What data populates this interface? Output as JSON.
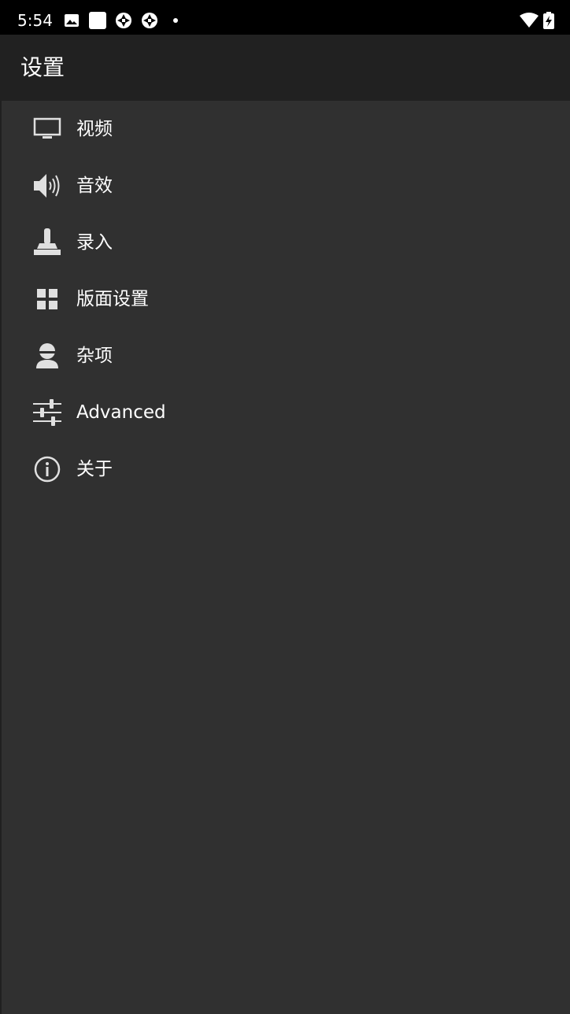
{
  "status_bar": {
    "time": "5:54",
    "left_icons": [
      "image-icon",
      "square-app-icon",
      "aperture-icon",
      "aperture-icon",
      "dot-icon"
    ],
    "right_icons": [
      "wifi-icon",
      "battery-charging-icon"
    ]
  },
  "toolbar": {
    "title": "设置"
  },
  "menu": {
    "items": [
      {
        "label": "视频",
        "icon": "monitor-icon"
      },
      {
        "label": "音效",
        "icon": "speaker-icon"
      },
      {
        "label": "录入",
        "icon": "joystick-icon"
      },
      {
        "label": "版面设置",
        "icon": "grid-icon"
      },
      {
        "label": "杂项",
        "icon": "person-icon"
      },
      {
        "label": "Advanced",
        "icon": "sliders-icon"
      },
      {
        "label": "关于",
        "icon": "info-icon"
      }
    ]
  },
  "colors": {
    "status_bar_bg": "#000000",
    "toolbar_bg": "#212121",
    "content_bg": "#303030",
    "text": "#ffffff",
    "icon": "#e0e0e0"
  }
}
